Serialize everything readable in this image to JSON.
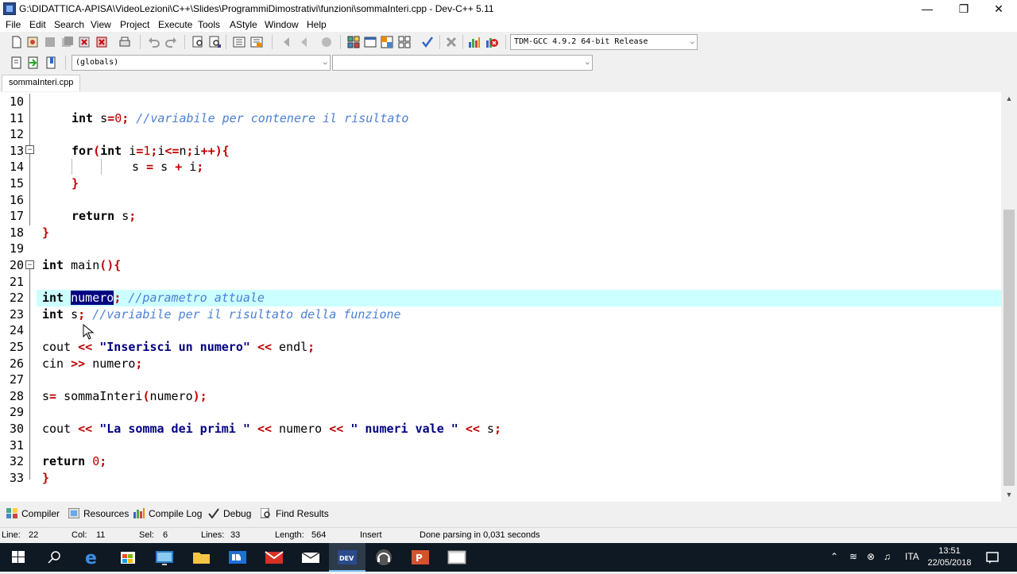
{
  "window": {
    "title": "G:\\DIDATTICA-APISA\\VideoLezioni\\C++\\Slides\\ProgrammiDimostrativi\\funzioni\\sommaInteri.cpp - Dev-C++ 5.11",
    "minimize": "—",
    "restore": "❐",
    "close": "✕"
  },
  "menu": [
    "File",
    "Edit",
    "Search",
    "View",
    "Project",
    "Execute",
    "Tools",
    "AStyle",
    "Window",
    "Help"
  ],
  "toolbar": {
    "compiler_select": "TDM-GCC 4.9.2 64-bit Release",
    "scope_select": "(globals)",
    "member_select": ""
  },
  "tabs": {
    "file": "sommaInteri.cpp"
  },
  "editor": {
    "line_numbers": [
      "10",
      "11",
      "12",
      "13",
      "14",
      "15",
      "16",
      "17",
      "18",
      "19",
      "20",
      "21",
      "22",
      "23",
      "24",
      "25",
      "26",
      "27",
      "28",
      "29",
      "30",
      "31",
      "32",
      "33"
    ],
    "code": {
      "l11": {
        "kw": "int",
        "a": " s",
        "eq": "=",
        "n": "0",
        "sc": ";",
        "cm": " //variabile per contenere il risultato"
      },
      "l13": {
        "kw": "for",
        "p1": "(",
        "kw2": "int",
        "a": " i",
        "eq": "=",
        "n": "1",
        "sc": ";",
        "b": "i",
        "le": "<=",
        "c": "n",
        "sc2": ";",
        "d": "i",
        "pp": "++",
        "p2": "){"
      },
      "l14": {
        "a": "s ",
        "eq": "=",
        "b": " s ",
        "plus": "+",
        "c": " i",
        "sc": ";"
      },
      "l15": {
        "br": "}"
      },
      "l17": {
        "kw": "return",
        "a": " s",
        "sc": ";"
      },
      "l18": {
        "br": "}"
      },
      "l20": {
        "kw": "int",
        "a": " main",
        "p": "(){"
      },
      "l22": {
        "kw": "int",
        "sp": " ",
        "sel": "numero",
        "sc": ";",
        "cm": " //parametro attuale"
      },
      "l23": {
        "kw": "int",
        "a": " s",
        "sc": ";",
        "cm": " //variabile per il risultato della funzione"
      },
      "l25": {
        "a": "cout ",
        "op": "<<",
        "sp": " ",
        "str": "\"Inserisci un numero\"",
        "sp2": " ",
        "op2": "<<",
        "b": " endl",
        "sc": ";"
      },
      "l26": {
        "a": "cin ",
        "op": ">>",
        "b": " numero",
        "sc": ";"
      },
      "l28": {
        "a": "s",
        "eq": "=",
        "b": " sommaInteri",
        "p1": "(",
        "c": "numero",
        "p2": ");"
      },
      "l30": {
        "a": "cout ",
        "op": "<<",
        "sp": " ",
        "str": "\"La somma dei primi \"",
        "sp2": " ",
        "op2": "<<",
        "b": " numero ",
        "op3": "<<",
        "sp3": " ",
        "str2": "\" numeri vale \"",
        "sp4": " ",
        "op4": "<<",
        "c": " s",
        "sc": ";"
      },
      "l32": {
        "kw": "return",
        "sp": " ",
        "n": "0",
        "sc": ";"
      },
      "l33": {
        "br": "}"
      }
    }
  },
  "bottom_tabs": [
    "Compiler",
    "Resources",
    "Compile Log",
    "Debug",
    "Find Results"
  ],
  "status": {
    "line": "Line:",
    "line_val": "22",
    "col": "Col:",
    "col_val": "11",
    "sel": "Sel:",
    "sel_val": "6",
    "lines": "Lines:",
    "lines_val": "33",
    "length": "Length:",
    "length_val": "564",
    "mode": "Insert",
    "message": "Done parsing in 0,031 seconds"
  },
  "taskbar": {
    "lang": "ITA",
    "time": "13:51",
    "date": "22/05/2018"
  },
  "colors": {
    "keyword": "#000000",
    "symbol": "#c00000",
    "comment": "#4a7fd6",
    "string": "#000080",
    "current_line": "#ccffff",
    "selection": "#000080"
  }
}
